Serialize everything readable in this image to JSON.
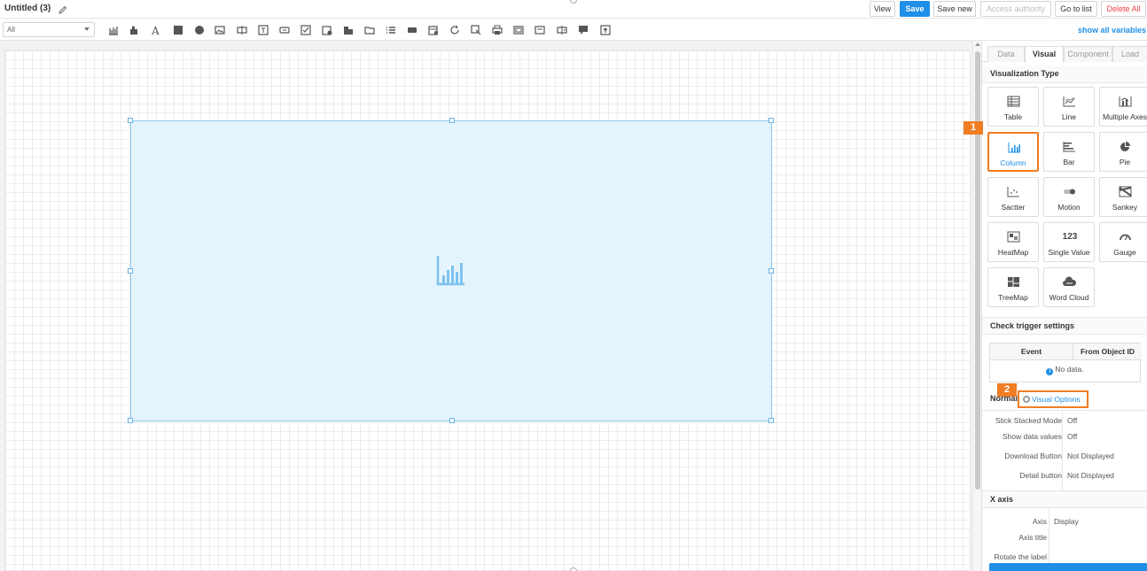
{
  "app": {
    "title": "Untitled (3)"
  },
  "header": {
    "buttons": {
      "view": "View",
      "save": "Save",
      "save_new": "Save new",
      "access_authority": "Access authority",
      "go_to_list": "Go to list",
      "delete_all": "Delete All"
    }
  },
  "toolbar": {
    "filter_value": "All",
    "show_all_variables": "show all variables",
    "tools": [
      "column-chart",
      "puzzle",
      "text",
      "rectangle",
      "circle",
      "image",
      "input",
      "textbox",
      "button",
      "checkbox",
      "date-filter",
      "tabs",
      "folder",
      "list",
      "tag",
      "calendar",
      "refresh",
      "export",
      "print",
      "frame",
      "panel",
      "split",
      "comment",
      "upload"
    ]
  },
  "panel": {
    "tabs": [
      "Data",
      "Visual",
      "Component",
      "Load"
    ],
    "active_tab": "Visual",
    "visualization_type_title": "Visualization Type",
    "viz_types": [
      {
        "label": "Table",
        "icon": "table-icon"
      },
      {
        "label": "Line",
        "icon": "line-chart-icon"
      },
      {
        "label": "Multiple Axes",
        "icon": "multiple-axes-icon"
      },
      {
        "label": "Column",
        "icon": "column-chart-icon",
        "selected": true
      },
      {
        "label": "Bar",
        "icon": "bar-chart-icon"
      },
      {
        "label": "Pie",
        "icon": "pie-chart-icon"
      },
      {
        "label": "Sactter",
        "icon": "scatter-chart-icon"
      },
      {
        "label": "Motion",
        "icon": "motion-chart-icon"
      },
      {
        "label": "Sankey",
        "icon": "sankey-chart-icon"
      },
      {
        "label": "HeatMap",
        "icon": "heatmap-icon"
      },
      {
        "label": "Single Value",
        "icon": "single-value-icon",
        "glyph": "123"
      },
      {
        "label": "Gauge",
        "icon": "gauge-icon"
      },
      {
        "label": "TreeMap",
        "icon": "treemap-icon"
      },
      {
        "label": "Word Cloud",
        "icon": "word-cloud-icon"
      }
    ],
    "badge_1": "1",
    "badge_2": "2",
    "check_trigger_title": "Check trigger settings",
    "trigger_table": {
      "headers": [
        "Event",
        "From Object ID"
      ],
      "empty": "No data."
    },
    "options_tabs": {
      "normal": "Normal",
      "visual_options": "Visual Options"
    },
    "options": [
      {
        "key": "Stick Stacked Mode",
        "value": "Off"
      },
      {
        "key": "Show data values",
        "value": "Off"
      },
      {
        "key": "Download Button",
        "value": "Not Displayed"
      },
      {
        "key": "Detail button",
        "value": "Not Displayed"
      }
    ],
    "x_axis_title": "X axis",
    "x_axis": [
      {
        "key": "Axis",
        "value": "Display"
      },
      {
        "key": "Axis title",
        "value": ""
      },
      {
        "key": "Rotate the label",
        "value": ""
      }
    ]
  },
  "colors": {
    "accent": "#1f8fe8",
    "highlight": "#f07c23",
    "widget_fill": "#e4f4fc",
    "widget_border": "#8ec8ee"
  }
}
